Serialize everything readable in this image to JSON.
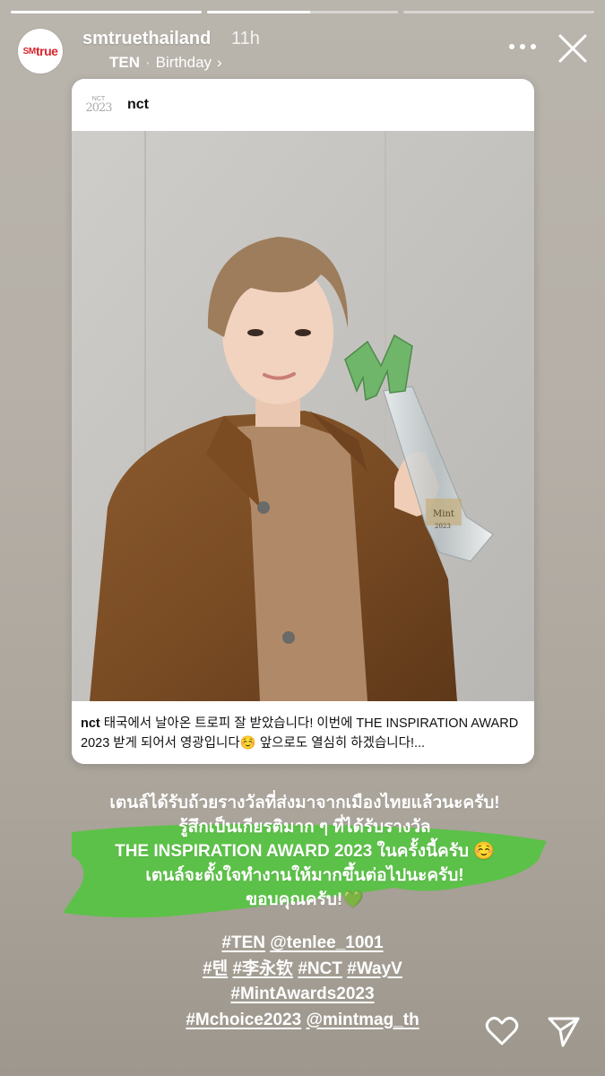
{
  "progress": {
    "segments": [
      1.0,
      0.54,
      0.0
    ]
  },
  "header": {
    "avatar_logo_sm": "SM",
    "avatar_logo_true": "true",
    "username": "smtruethailand",
    "time": "11h",
    "sub_bold": "TEN",
    "sub_separator": "·",
    "sub_text": "Birthday",
    "sub_chevron": "›"
  },
  "card": {
    "logo_top": "NCT",
    "logo_year": "2023",
    "username": "nct",
    "trophy_plate_top": "Mint",
    "trophy_plate_year": "2023",
    "caption_user": "nct",
    "caption_text": " 태국에서 날아온 트로피 잘 받았습니다! 이번에 THE INSPIRATION AWARD 2023 받게 되어서 영광입니다☺️ 앞으로도 열심히 하겠습니다!..."
  },
  "story_text": {
    "line1": "เตนล์ได้รับถ้วยรางวัลที่ส่งมาจากเมืองไทยแล้วนะครับ!",
    "line2": "รู้สึกเป็นเกียรติมาก ๆ ที่ได้รับรางวัล",
    "line3": "THE INSPIRATION AWARD 2023 ในครั้งนี้ครับ ☺️",
    "line4": "เตนล์จะตั้งใจทำงานให้มากขึ้นต่อไปนะครับ!",
    "line5": "ขอบคุณครับ!💚",
    "highlight_color": "#5cc148"
  },
  "tags": {
    "t1": "#TEN",
    "t2": "@tenlee_1001",
    "t3": "#텐",
    "t4": "#李永钦",
    "t5": "#NCT",
    "t6": "#WayV",
    "t7": "#MintAwards2023",
    "t8": "#Mchoice2023",
    "t9": "@mintmag_th"
  },
  "icons": {
    "more": "more-horizontal-icon",
    "close": "close-icon",
    "like": "heart-icon",
    "share": "send-icon"
  }
}
